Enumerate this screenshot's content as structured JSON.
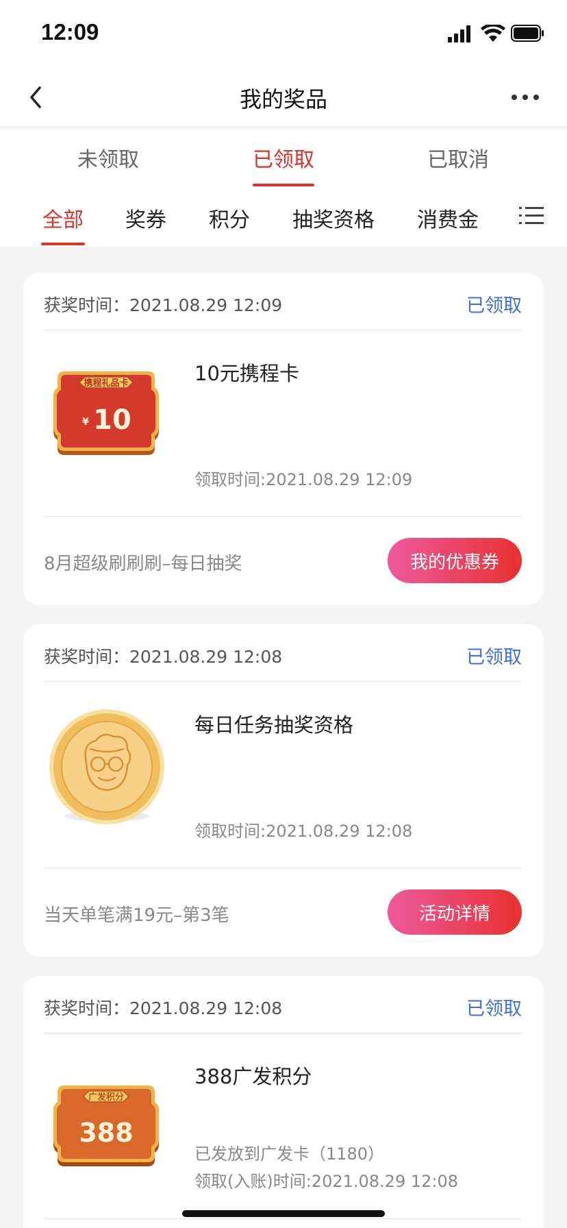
{
  "status_bar": {
    "time": "12:09"
  },
  "nav": {
    "title": "我的奖品"
  },
  "status_tabs": [
    {
      "label": "未领取",
      "active": false
    },
    {
      "label": "已领取",
      "active": true
    },
    {
      "label": "已取消",
      "active": false
    }
  ],
  "category_tabs": [
    {
      "label": "全部",
      "active": true
    },
    {
      "label": "奖券",
      "active": false
    },
    {
      "label": "积分",
      "active": false
    },
    {
      "label": "抽奖资格",
      "active": false
    },
    {
      "label": "消费金",
      "active": false
    }
  ],
  "cards": [
    {
      "award_time": "获奖时间：2021.08.29 12:09",
      "status": "已领取",
      "prize_name": "10元携程卡",
      "prize_image": {
        "icon": "ctrip-gift-card-icon",
        "badge": "携程礼品卡",
        "currency": "¥",
        "amount": "10",
        "color": "#d43a2c"
      },
      "detail_lines": [
        "领取时间:2021.08.29 12:09"
      ],
      "source": "8月超级刷刷刷–每日抽奖",
      "button": "我的优惠券"
    },
    {
      "award_time": "获奖时间：2021.08.29 12:08",
      "status": "已领取",
      "prize_name": "每日任务抽奖资格",
      "prize_image": {
        "icon": "gold-coin-grandma-icon"
      },
      "detail_lines": [
        "领取时间:2021.08.29 12:08"
      ],
      "source": "当天单笔满19元–第3笔",
      "button": "活动详情"
    },
    {
      "award_time": "获奖时间：2021.08.29 12:08",
      "status": "已领取",
      "prize_name": "388广发积分",
      "prize_image": {
        "icon": "cgb-points-card-icon",
        "badge": "广发积分",
        "amount": "388",
        "color": "#d8692a"
      },
      "detail_lines": [
        "已发放到广发卡（1180）",
        "领取(入账)时间:2021.08.29 12:08"
      ]
    }
  ],
  "colors": {
    "accent_red": "#d9322b",
    "status_blue": "#3c6fdc",
    "button_gradient_start": "#ec5a9c",
    "button_gradient_end": "#ea3030"
  }
}
